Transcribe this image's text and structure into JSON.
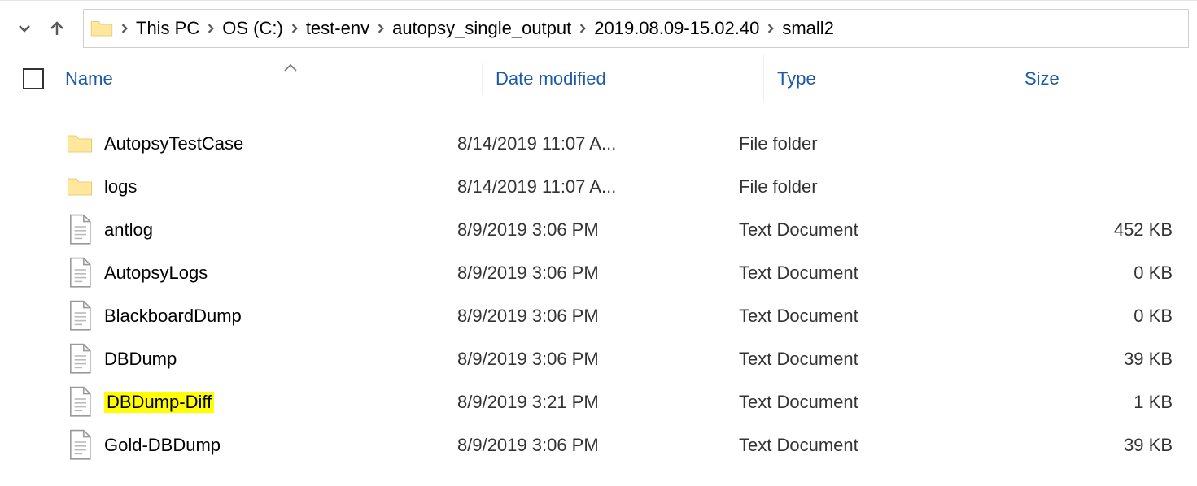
{
  "breadcrumbs": [
    "This PC",
    "OS (C:)",
    "test-env",
    "autopsy_single_output",
    "2019.08.09-15.02.40",
    "small2"
  ],
  "columns": {
    "name": "Name",
    "date": "Date modified",
    "type": "Type",
    "size": "Size"
  },
  "files": [
    {
      "icon": "folder",
      "name": "AutopsyTestCase",
      "date": "8/14/2019 11:07 A...",
      "type": "File folder",
      "size": "",
      "highlight": false
    },
    {
      "icon": "folder",
      "name": "logs",
      "date": "8/14/2019 11:07 A...",
      "type": "File folder",
      "size": "",
      "highlight": false
    },
    {
      "icon": "text",
      "name": "antlog",
      "date": "8/9/2019 3:06 PM",
      "type": "Text Document",
      "size": "452 KB",
      "highlight": false
    },
    {
      "icon": "text",
      "name": "AutopsyLogs",
      "date": "8/9/2019 3:06 PM",
      "type": "Text Document",
      "size": "0 KB",
      "highlight": false
    },
    {
      "icon": "text",
      "name": "BlackboardDump",
      "date": "8/9/2019 3:06 PM",
      "type": "Text Document",
      "size": "0 KB",
      "highlight": false
    },
    {
      "icon": "text",
      "name": "DBDump",
      "date": "8/9/2019 3:06 PM",
      "type": "Text Document",
      "size": "39 KB",
      "highlight": false
    },
    {
      "icon": "text",
      "name": "DBDump-Diff",
      "date": "8/9/2019 3:21 PM",
      "type": "Text Document",
      "size": "1 KB",
      "highlight": true
    },
    {
      "icon": "text",
      "name": "Gold-DBDump",
      "date": "8/9/2019 3:06 PM",
      "type": "Text Document",
      "size": "39 KB",
      "highlight": false
    }
  ]
}
